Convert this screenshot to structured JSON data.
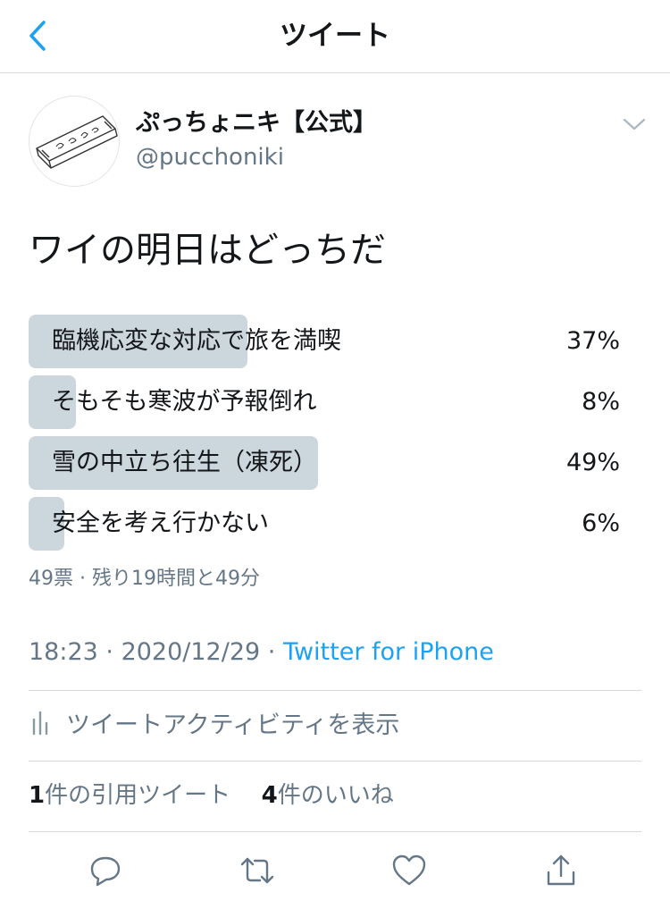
{
  "header": {
    "title": "ツイート",
    "back_icon": "chevron-left-icon"
  },
  "user": {
    "display_name": "ぷっちょニキ【公式】",
    "handle": "@pucchoniki"
  },
  "tweet": {
    "text": "ワイの明日はどっちだ"
  },
  "poll": {
    "options": [
      {
        "label": "臨機応変な対応で旅を満喫",
        "percent_text": "37%",
        "percent": 37
      },
      {
        "label": "そもそも寒波が予報倒れ",
        "percent_text": "8%",
        "percent": 8
      },
      {
        "label": "雪の中立ち往生（凍死）",
        "percent_text": "49%",
        "percent": 49
      },
      {
        "label": "安全を考え行かない",
        "percent_text": "6%",
        "percent": 6
      }
    ],
    "meta": "49票 · 残り19時間と49分"
  },
  "meta": {
    "time": "18:23",
    "date": "2020/12/29",
    "source": "Twitter for iPhone",
    "sep": " · "
  },
  "activity": {
    "label": "ツイートアクティビティを表示"
  },
  "stats": {
    "quotes_count": "1",
    "quotes_label": "件の引用ツイート",
    "likes_count": "4",
    "likes_label": "件のいいね"
  },
  "colors": {
    "accent": "#1da1f2",
    "poll_bar": "#ccd6dd",
    "secondary_text": "#657786"
  }
}
